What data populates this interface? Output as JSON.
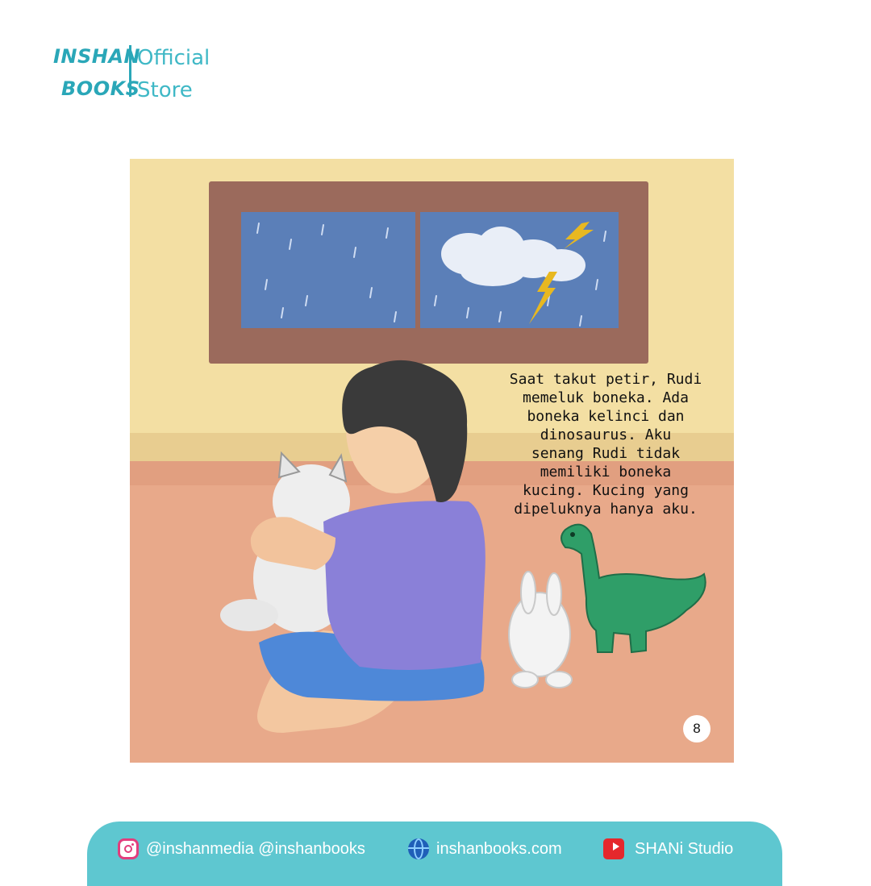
{
  "brand": {
    "name_line1": "INSHAN",
    "name_line2": "BOOKS",
    "tag_line1": "Official",
    "tag_line2": "Store",
    "color": "#2aa7b8"
  },
  "story_page": {
    "text": "Saat takut petir, Rudi\nmemeluk boneka. Ada\nboneka kelinci dan\ndinosaurus. Aku\nsenang Rudi tidak\nmemiliki boneka\nkucing. Kucing yang\ndipeluknya hanya aku.",
    "page_number": "8",
    "illustration": {
      "wall_color": "#f3dfa3",
      "floor_color": "#e8a98a",
      "window_frame_color": "#9b6a5c",
      "window_glass_color": "#5b7fb8",
      "lightning_color": "#e8b820",
      "shirt_color": "#8a80d8",
      "shorts_color": "#4e88d8",
      "dino_color": "#2f9e68"
    }
  },
  "footer": {
    "instagram_icon": "instagram-icon",
    "instagram_text": "@inshanmedia @inshanbooks",
    "website_icon": "globe-icon",
    "website_text": "inshanbooks.com",
    "youtube_icon": "youtube-icon",
    "youtube_text": "SHANi Studio",
    "background": "#5ec7d0"
  }
}
